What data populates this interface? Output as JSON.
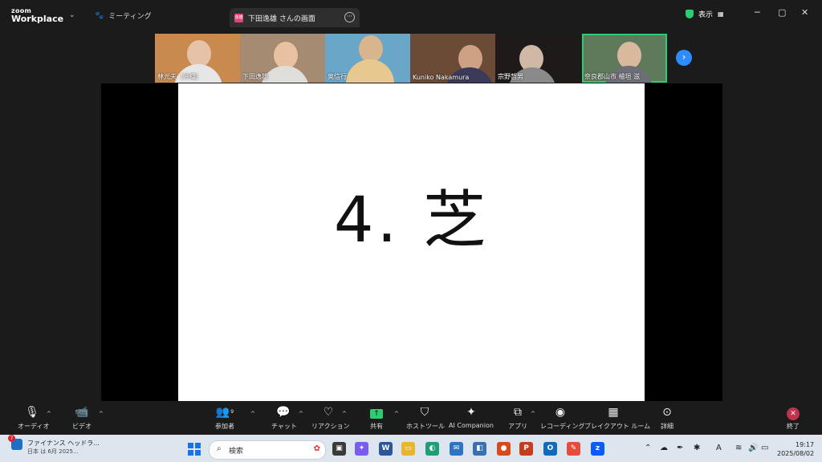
{
  "titlebar": {
    "logo_top": "zoom",
    "logo_bottom": "Workplace",
    "meeting_label": "ミーティング",
    "share_tab_label": "下田逸雄 さんの画面",
    "share_tab_icon_text": "逸雄",
    "view_label": "表示"
  },
  "participants": [
    {
      "name": "林光夫（沖縄）",
      "bg": "#c98a50"
    },
    {
      "name": "下田逸雄",
      "bg": "#a68b73"
    },
    {
      "name": "奥信行",
      "bg": "#6aa6c7"
    },
    {
      "name": "Kuniko Nakamura",
      "bg": "#6b4b35"
    },
    {
      "name": "宗野哲男",
      "bg": "#1f1a1a"
    },
    {
      "name": "奈良郡山市 檜垣 滋",
      "bg": "#5e7a5a"
    }
  ],
  "slide": {
    "text": "4.  芝"
  },
  "toolbar": {
    "audio": "オーディオ",
    "video": "ビデオ",
    "participants": "参加者",
    "participants_count": "9",
    "chat": "チャット",
    "reactions": "リアクション",
    "share": "共有",
    "host_tools": "ホストツール",
    "ai_companion": "AI Companion",
    "apps": "アプリ",
    "recording": "レコーディング",
    "breakout": "ブレイクアウト ルーム",
    "more": "詳細",
    "end": "終了"
  },
  "taskbar": {
    "news_title": "ファイナンス ヘッドラ...",
    "news_sub": "日本 は 6月 2025...",
    "news_badge": "7",
    "search_placeholder": "検索",
    "time": "19:17",
    "date": "2025/08/02"
  }
}
